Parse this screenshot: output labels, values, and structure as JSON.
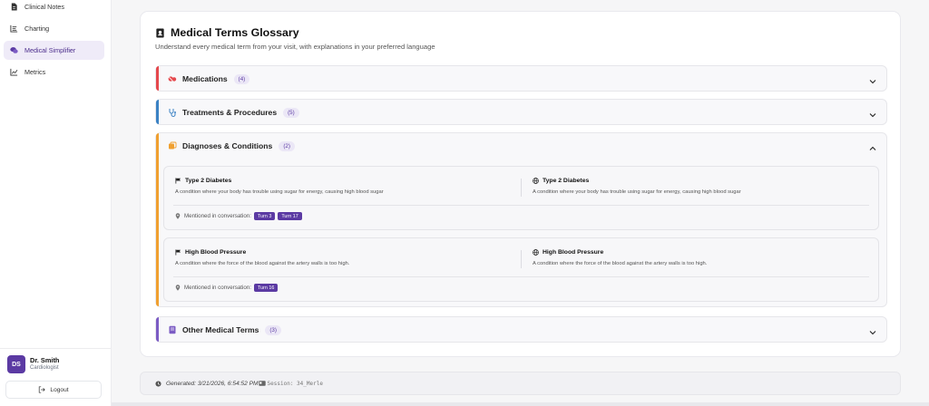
{
  "sidebar": {
    "items": [
      {
        "label": "Clinical Notes",
        "icon": "file-icon"
      },
      {
        "label": "Charting",
        "icon": "list-icon"
      },
      {
        "label": "Medical Simplifier",
        "icon": "chat-icon",
        "active": true
      },
      {
        "label": "Metrics",
        "icon": "chart-icon"
      }
    ],
    "user": {
      "initials": "DS",
      "name": "Dr. Smith",
      "role": "Cardiologist"
    },
    "logout_label": "Logout"
  },
  "glossary": {
    "title": "Medical Terms Glossary",
    "subtitle": "Understand every medical term from your visit, with explanations in your preferred language",
    "sections": [
      {
        "label": "Medications",
        "count": "(4)",
        "color": "#e5484d",
        "expanded": false
      },
      {
        "label": "Treatments & Procedures",
        "count": "(5)",
        "color": "#3b82c4",
        "expanded": false
      },
      {
        "label": "Diagnoses & Conditions",
        "count": "(2)",
        "color": "#f0a030",
        "expanded": true
      },
      {
        "label": "Other Medical Terms",
        "count": "(3)",
        "color": "#7c5cc4",
        "expanded": false
      }
    ],
    "terms": [
      {
        "name_en": "Type 2 Diabetes",
        "desc_en": "A condition where your body has trouble using sugar for energy, causing high blood sugar",
        "name_tr": "Type 2 Diabetes",
        "desc_tr": "A condition where your body has trouble using sugar for energy, causing high blood sugar",
        "mention_label": "Mentioned in conversation:",
        "turns": [
          "Turn 3",
          "Turn 17"
        ]
      },
      {
        "name_en": "High Blood Pressure",
        "desc_en": "A condition where the force of the blood against the artery walls is too high.",
        "name_tr": "High Blood Pressure",
        "desc_tr": "A condition where the force of the blood against the artery walls is too high.",
        "mention_label": "Mentioned in conversation:",
        "turns": [
          "Turn 16"
        ]
      }
    ]
  },
  "footer": {
    "generated": "Generated: 3/21/2026, 6:54:52 PM",
    "session": "Session: 34_Merle"
  },
  "colors": {
    "accent": "#5b3aa3",
    "active_bg": "#efebf8"
  }
}
